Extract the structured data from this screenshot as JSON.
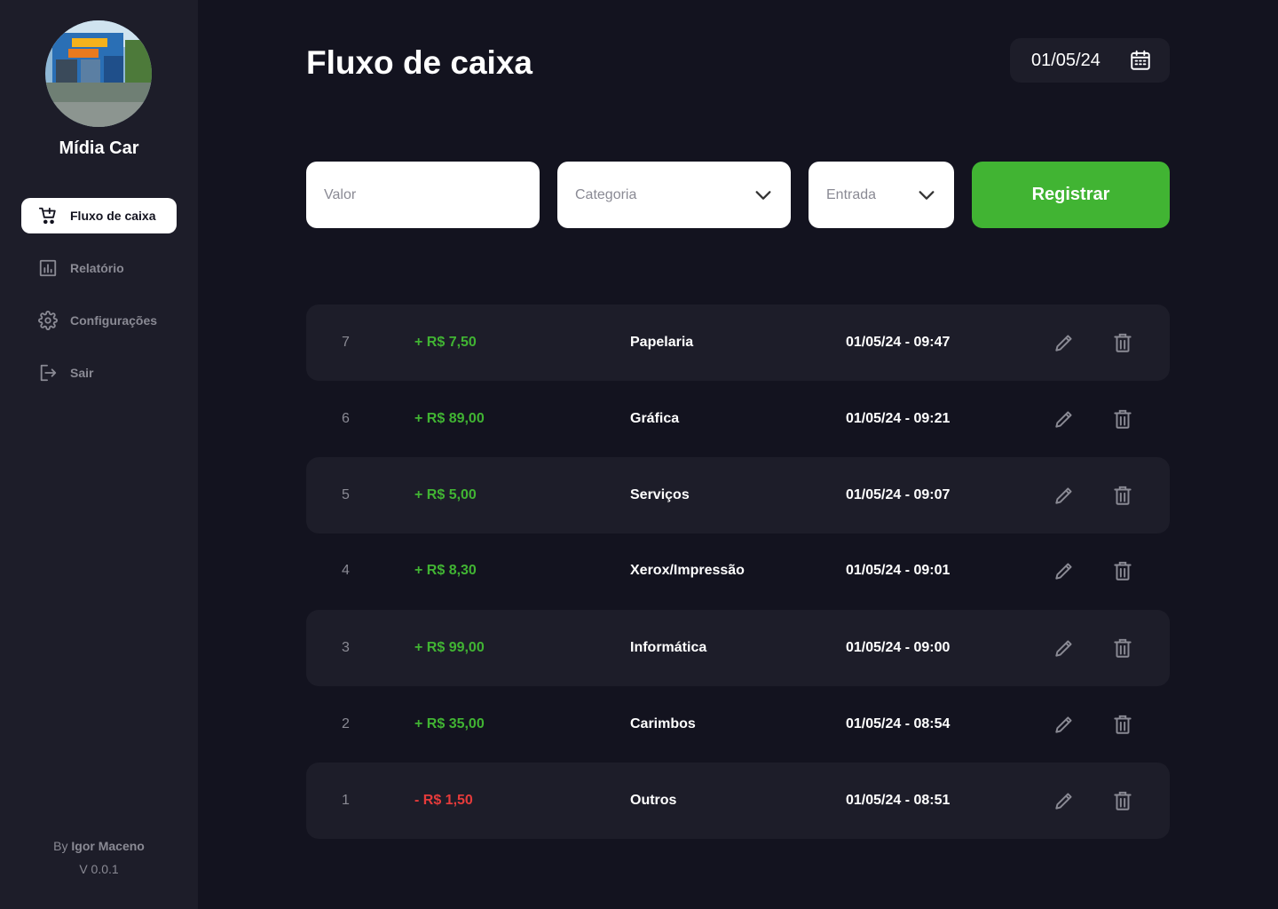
{
  "sidebar": {
    "brand_name": "Mídia Car",
    "items": [
      {
        "label": "Fluxo de caixa",
        "icon": "cart-plus-icon",
        "active": true
      },
      {
        "label": "Relatório",
        "icon": "bar-chart-icon",
        "active": false
      },
      {
        "label": "Configurações",
        "icon": "gear-icon",
        "active": false
      },
      {
        "label": "Sair",
        "icon": "logout-icon",
        "active": false
      }
    ],
    "footer": {
      "by_prefix": "By",
      "author": "Igor Maceno",
      "version": "V 0.0.1"
    }
  },
  "header": {
    "title": "Fluxo de caixa",
    "date": "01/05/24"
  },
  "form": {
    "valor_placeholder": "Valor",
    "categoria_value": "Categoria",
    "tipo_value": "Entrada",
    "submit_label": "Registrar"
  },
  "transactions": [
    {
      "id": "7",
      "amount": "+ R$ 7,50",
      "category": "Papelaria",
      "datetime": "01/05/24 - 09:47"
    },
    {
      "id": "6",
      "amount": "+ R$ 89,00",
      "category": "Gráfica",
      "datetime": "01/05/24 - 09:21"
    },
    {
      "id": "5",
      "amount": "+ R$ 5,00",
      "category": "Serviços",
      "datetime": "01/05/24 - 09:07"
    },
    {
      "id": "4",
      "amount": "+ R$ 8,30",
      "category": "Xerox/Impressão",
      "datetime": "01/05/24 - 09:01"
    },
    {
      "id": "3",
      "amount": "+ R$ 99,00",
      "category": "Informática",
      "datetime": "01/05/24 - 09:00"
    },
    {
      "id": "2",
      "amount": "+ R$ 35,00",
      "category": "Carimbos",
      "datetime": "01/05/24 - 08:54"
    },
    {
      "id": "1",
      "amount": "- R$ 1,50",
      "category": "Outros",
      "datetime": "01/05/24 - 08:51"
    }
  ],
  "colors": {
    "background": "#13131f",
    "panel": "#1d1d29",
    "accent_green": "#41b433",
    "negative_red": "#e63b3b",
    "muted_text": "#8a8a94"
  }
}
